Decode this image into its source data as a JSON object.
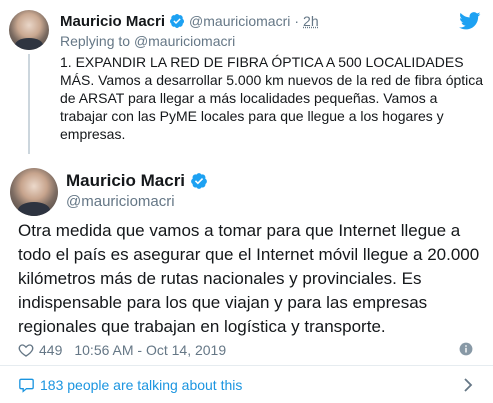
{
  "brand": {
    "accent": "#1da1f2",
    "link": "#1b95e0",
    "muted": "#657786",
    "text": "#14171a"
  },
  "parent_tweet": {
    "author_name": "Mauricio Macri",
    "handle": "@mauriciomacri",
    "separator": "·",
    "time": "2h",
    "replying_prefix": "Replying to",
    "replying_handle": "@mauriciomacri",
    "text": "1. EXPANDIR LA RED DE FIBRA ÓPTICA A 500 LOCALIDADES MÁS. Vamos a desarrollar 5.000 km nuevos de la red de fibra óptica de ARSAT para llegar a más localidades pequeñas. Vamos a trabajar con las PyME locales para que llegue a los hogares y empresas.",
    "icons": {
      "verified": "verified-badge-icon",
      "brand": "twitter-bird-icon"
    }
  },
  "main_tweet": {
    "author_name": "Mauricio Macri",
    "handle": "@mauriciomacri",
    "text": "Otra medida que vamos a tomar para que Internet llegue a todo el país es asegurar que el Internet móvil llegue a 20.000 kilómetros más de rutas nacionales y provinciales. Es indispensable para los que viajan y para las empresas regionales que trabajan en logística y transporte.",
    "likes": "449",
    "timestamp": "10:56 AM - Oct 14, 2019",
    "icons": {
      "verified": "verified-badge-icon",
      "like": "heart-icon",
      "info": "info-icon"
    }
  },
  "footer": {
    "talking_text": "183 people are talking about this",
    "icons": {
      "conversation": "speech-bubble-icon",
      "navigate": "chevron-right-icon"
    }
  }
}
